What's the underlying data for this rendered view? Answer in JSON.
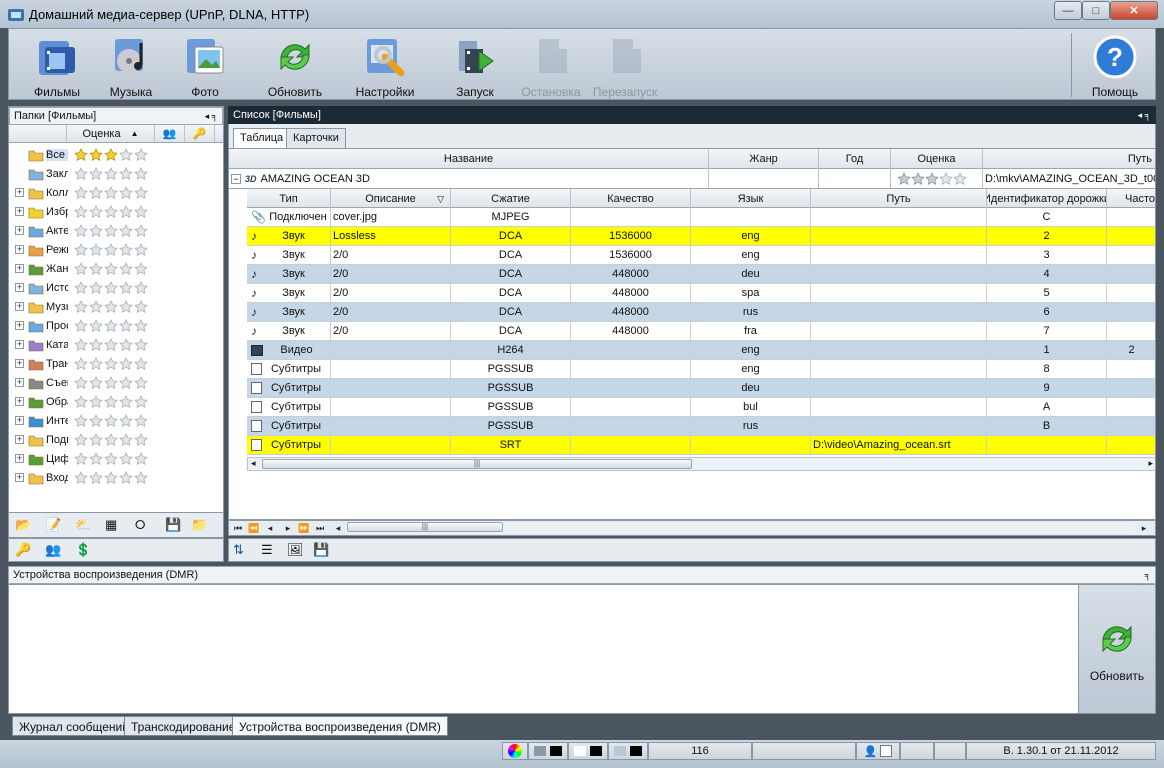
{
  "window": {
    "title": "Домашний медиа-сервер (UPnP, DLNA, HTTP)",
    "minimize": "—",
    "maximize": "□",
    "close": "✕"
  },
  "toolbar": {
    "movies": "Фильмы",
    "music": "Музыка",
    "photo": "Фото",
    "refresh": "Обновить",
    "settings": "Настройки",
    "start": "Запуск",
    "stop": "Остановка",
    "restart": "Перезапуск",
    "help": "Помощь"
  },
  "folders": {
    "title": "Папки [Фильмы]",
    "rating_header": "Оценка",
    "items": [
      {
        "name": "Все",
        "rating": 3,
        "expand": ""
      },
      {
        "name": "Закладки",
        "rating": 0,
        "expand": ""
      },
      {
        "name": "Коллекции",
        "rating": 0,
        "expand": "+"
      },
      {
        "name": "Избранное",
        "rating": 0,
        "expand": "+"
      },
      {
        "name": "Актеры",
        "rating": 0,
        "expand": "+"
      },
      {
        "name": "Режиссеры",
        "rating": 0,
        "expand": "+"
      },
      {
        "name": "Жанры",
        "rating": 0,
        "expand": "+"
      },
      {
        "name": "История",
        "rating": 0,
        "expand": "+"
      },
      {
        "name": "Музыка",
        "rating": 0,
        "expand": "+"
      },
      {
        "name": "Просмотр",
        "rating": 0,
        "expand": "+"
      },
      {
        "name": "Каталоги",
        "rating": 0,
        "expand": "+"
      },
      {
        "name": "Трансляция",
        "rating": 0,
        "expand": "+"
      },
      {
        "name": "Съемка",
        "rating": 0,
        "expand": "+"
      },
      {
        "name": "Обработка",
        "rating": 0,
        "expand": "+"
      },
      {
        "name": "Интернет",
        "rating": 0,
        "expand": "+"
      },
      {
        "name": "Подкасты",
        "rating": 0,
        "expand": "+"
      },
      {
        "name": "Цифровое",
        "rating": 0,
        "expand": "+"
      },
      {
        "name": "Входящие",
        "rating": 0,
        "expand": "+"
      }
    ]
  },
  "list": {
    "title": "Список [Фильмы]",
    "tabs": [
      "Таблица",
      "Карточки"
    ],
    "columns": {
      "name": "Название",
      "genre": "Жанр",
      "year": "Год",
      "rating": "Оценка",
      "path": "Путь"
    },
    "movie": {
      "name": "AMAZING OCEAN 3D",
      "genre": "",
      "year": "",
      "rating": 3,
      "path": "D:\\mkv\\AMAZING_OCEAN_3D_t00.m"
    },
    "sub_columns": {
      "type": "Тип",
      "desc": "Описание",
      "codec": "Сжатие",
      "quality": "Качество",
      "lang": "Язык",
      "path": "Путь",
      "track_id": "Идентификатор дорожки",
      "freq": "Частота"
    },
    "tracks": [
      {
        "icon": "clip",
        "type": "Подключен",
        "desc": "cover.jpg",
        "codec": "MJPEG",
        "quality": "",
        "lang": "",
        "path": "",
        "id": "C",
        "freq": "",
        "style": "white"
      },
      {
        "icon": "audio",
        "type": "Звук",
        "desc": "Lossless",
        "codec": "DCA",
        "quality": "1536000",
        "lang": "eng",
        "path": "",
        "id": "2",
        "freq": "",
        "style": "yellow"
      },
      {
        "icon": "audio",
        "type": "Звук",
        "desc": "2/0",
        "codec": "DCA",
        "quality": "1536000",
        "lang": "eng",
        "path": "",
        "id": "3",
        "freq": "",
        "style": "white"
      },
      {
        "icon": "audio",
        "type": "Звук",
        "desc": "2/0",
        "codec": "DCA",
        "quality": "448000",
        "lang": "deu",
        "path": "",
        "id": "4",
        "freq": "",
        "style": "blue"
      },
      {
        "icon": "audio",
        "type": "Звук",
        "desc": "2/0",
        "codec": "DCA",
        "quality": "448000",
        "lang": "spa",
        "path": "",
        "id": "5",
        "freq": "",
        "style": "white"
      },
      {
        "icon": "audio",
        "type": "Звук",
        "desc": "2/0",
        "codec": "DCA",
        "quality": "448000",
        "lang": "rus",
        "path": "",
        "id": "6",
        "freq": "",
        "style": "blue"
      },
      {
        "icon": "audio",
        "type": "Звук",
        "desc": "2/0",
        "codec": "DCA",
        "quality": "448000",
        "lang": "fra",
        "path": "",
        "id": "7",
        "freq": "",
        "style": "white"
      },
      {
        "icon": "video",
        "type": "Видео",
        "desc": "",
        "codec": "H264",
        "quality": "",
        "lang": "eng",
        "path": "",
        "id": "1",
        "freq": "2",
        "style": "blue"
      },
      {
        "icon": "sub",
        "type": "Субтитры",
        "desc": "",
        "codec": "PGSSUB",
        "quality": "",
        "lang": "eng",
        "path": "",
        "id": "8",
        "freq": "",
        "style": "white"
      },
      {
        "icon": "sub",
        "type": "Субтитры",
        "desc": "",
        "codec": "PGSSUB",
        "quality": "",
        "lang": "deu",
        "path": "",
        "id": "9",
        "freq": "",
        "style": "blue"
      },
      {
        "icon": "sub",
        "type": "Субтитры",
        "desc": "",
        "codec": "PGSSUB",
        "quality": "",
        "lang": "bul",
        "path": "",
        "id": "A",
        "freq": "",
        "style": "white"
      },
      {
        "icon": "sub",
        "type": "Субтитры",
        "desc": "",
        "codec": "PGSSUB",
        "quality": "",
        "lang": "rus",
        "path": "",
        "id": "B",
        "freq": "",
        "style": "blue"
      },
      {
        "icon": "sub",
        "type": "Субтитры",
        "desc": "",
        "codec": "SRT",
        "quality": "",
        "lang": "",
        "path": "D:\\video\\Amazing_ocean.srt",
        "id": "",
        "freq": "",
        "style": "yellow"
      }
    ]
  },
  "dmr": {
    "title": "Устройства воспроизведения (DMR)",
    "refresh": "Обновить"
  },
  "bottom_tabs": [
    "Журнал сообщений",
    "Транскодирование",
    "Устройства воспроизведения (DMR)"
  ],
  "status": {
    "count": "116",
    "version": "В. 1.30.1 от 21.11.2012"
  },
  "colors": {
    "accent_dark": "#1c2a36",
    "row_blue": "#c5d6e6",
    "row_yellow": "#ffff00"
  }
}
